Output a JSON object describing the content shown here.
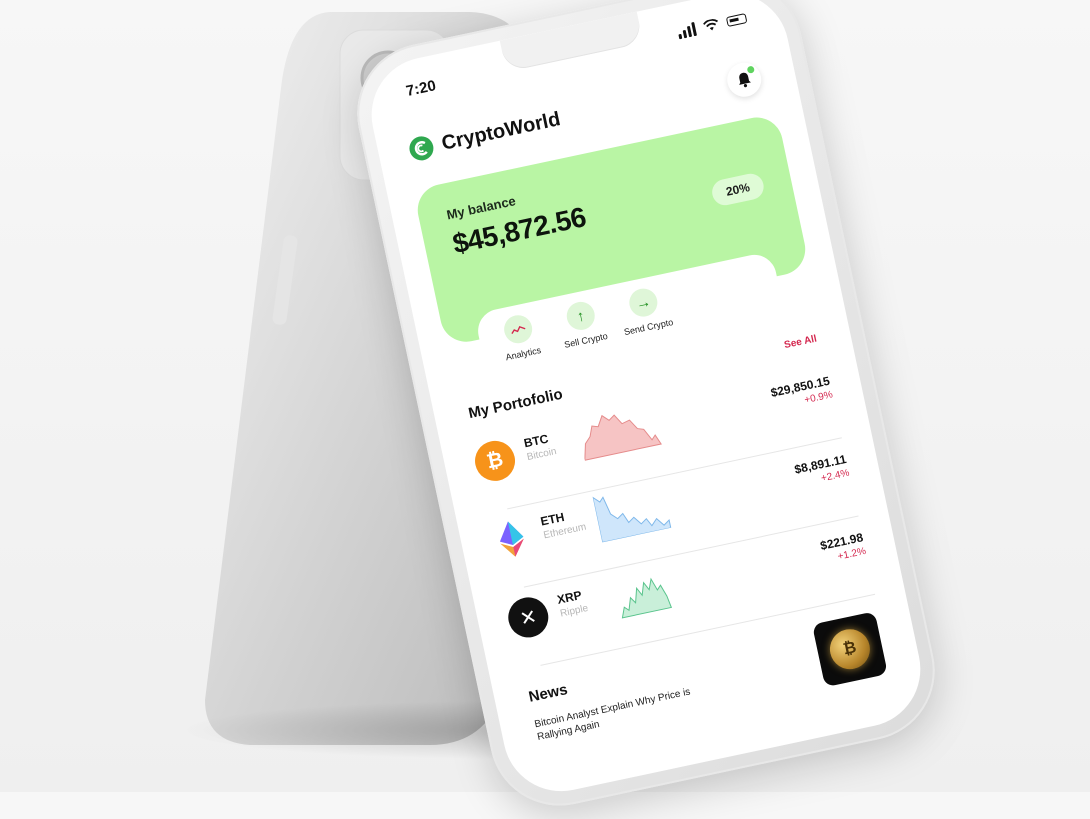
{
  "status_bar": {
    "time": "7:20"
  },
  "app": {
    "title": "CryptoWorld"
  },
  "balance": {
    "label": "My balance",
    "amount": "$45,872.56",
    "change": "20%"
  },
  "actions": [
    {
      "label": "Analytics",
      "icon": "analytics-icon"
    },
    {
      "label": "Sell Crypto",
      "icon": "arrow-up-icon"
    },
    {
      "label": "Send Crypto",
      "icon": "arrow-right-icon"
    }
  ],
  "portfolio": {
    "title": "My Portofolio",
    "see_all": "See All",
    "coins": [
      {
        "symbol": "BTC",
        "name": "Bitcoin",
        "price": "$29,850.15",
        "change": "+0.9%",
        "spark_color": "#f2a3a3"
      },
      {
        "symbol": "ETH",
        "name": "Ethereum",
        "price": "$8,891.11",
        "change": "+2.4%",
        "spark_color": "#a9d4f5"
      },
      {
        "symbol": "XRP",
        "name": "Ripple",
        "price": "$221.98",
        "change": "+1.2%",
        "spark_color": "#a6e3c4"
      }
    ]
  },
  "news": {
    "title": "News",
    "headline": "Bitcoin Analyst Explain Why Price is Rallying Again"
  },
  "colors": {
    "accent_green": "#b9f5a4",
    "negative_red": "#d4284f",
    "logo_green": "#2fa84f"
  }
}
